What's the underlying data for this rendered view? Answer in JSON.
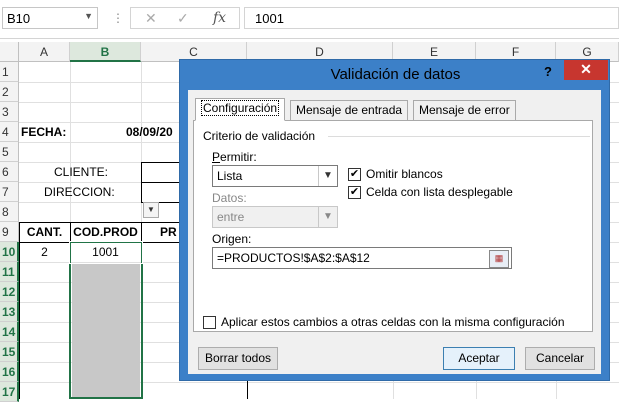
{
  "formula_bar": {
    "name_box": "B10",
    "cancel_icon": "✕",
    "enter_icon": "✓",
    "fx_label": "fx",
    "value": "1001"
  },
  "grid": {
    "columns": [
      "A",
      "B",
      "C",
      "D",
      "E",
      "F",
      "G"
    ],
    "rows": [
      "1",
      "2",
      "3",
      "4",
      "5",
      "6",
      "7",
      "8",
      "9",
      "10",
      "11",
      "12",
      "13",
      "14",
      "15",
      "16",
      "17"
    ],
    "selected_cell": "B10",
    "cells": {
      "a4": "FECHA:",
      "b4": "08/09/20",
      "a6": "CLIENTE:",
      "a7": "DIRECCION:",
      "a9": "CANT.",
      "b9": "COD.PROD",
      "c9": "PR",
      "a10": "2",
      "b10": "1001"
    }
  },
  "dialog": {
    "title": "Validación de datos",
    "help": "?",
    "close": "✕",
    "tabs": [
      "Configuración",
      "Mensaje de entrada",
      "Mensaje de error"
    ],
    "active_tab": 0,
    "group_label": "Criterio de validación",
    "allow_label": "Permitir:",
    "allow_value": "Lista",
    "ignore_blank_label": "Omitir blancos",
    "ignore_blank_checked": true,
    "dropdown_label": "Celda con lista desplegable",
    "dropdown_checked": true,
    "data_label": "Datos:",
    "data_value": "entre",
    "source_label": "Origen:",
    "source_value": "=PRODUCTOS!$A$2:$A$12",
    "apply_all_label": "Aplicar estos cambios a otras celdas con la misma configuración",
    "apply_all_checked": false,
    "clear_button": "Borrar todos",
    "ok_button": "Aceptar",
    "cancel_button": "Cancelar"
  }
}
